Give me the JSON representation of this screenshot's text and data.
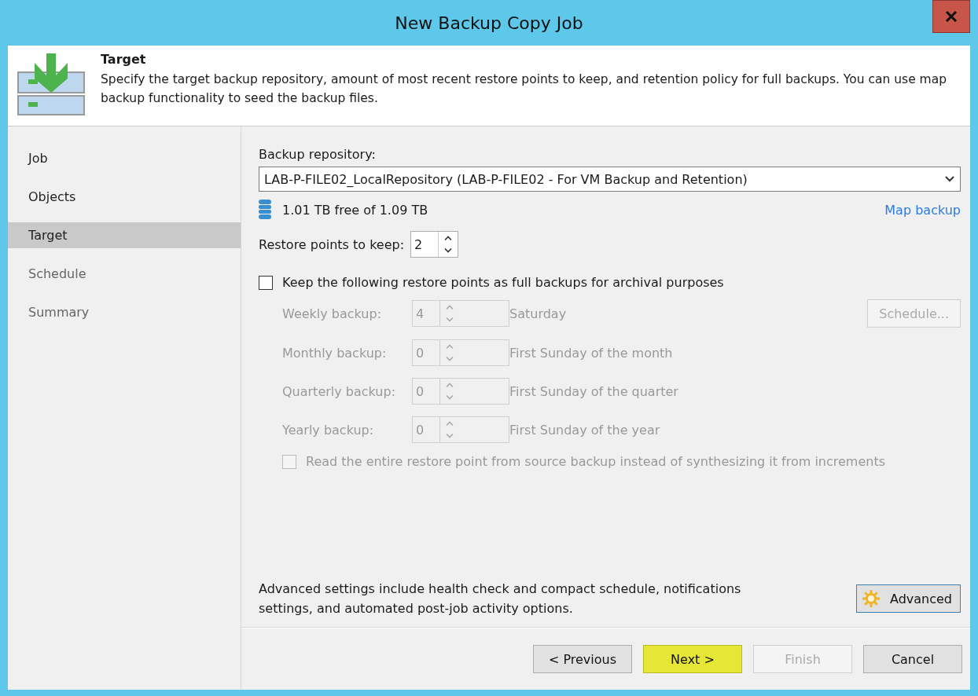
{
  "window": {
    "title": "New Backup Copy Job"
  },
  "header": {
    "title": "Target",
    "description": "Specify the target backup repository, amount of most recent restore points to keep, and retention policy for full backups. You can use map backup functionality to seed the backup files."
  },
  "steps": [
    {
      "label": "Job",
      "selected": false
    },
    {
      "label": "Objects",
      "selected": false
    },
    {
      "label": "Target",
      "selected": true
    },
    {
      "label": "Schedule",
      "selected": false
    },
    {
      "label": "Summary",
      "selected": false
    }
  ],
  "repository": {
    "label": "Backup repository:",
    "value": "LAB-P-FILE02_LocalRepository (LAB-P-FILE02 - For VM Backup and Retention)",
    "free": "1.01 TB free of 1.09 TB",
    "map_link": "Map backup"
  },
  "restore_points": {
    "label": "Restore points to keep:",
    "value": "2"
  },
  "archival": {
    "label": "Keep the following restore points as full backups for archival purposes",
    "checked": false
  },
  "retention": [
    {
      "label": "Weekly backup:",
      "value": "4",
      "when": "Saturday",
      "disabled": true
    },
    {
      "label": "Monthly backup:",
      "value": "0",
      "when": "First Sunday of the month",
      "disabled": true
    },
    {
      "label": "Quarterly backup:",
      "value": "0",
      "when": "First Sunday of the quarter",
      "disabled": true
    },
    {
      "label": "Yearly backup:",
      "value": "0",
      "when": "First Sunday of the year",
      "disabled": true
    }
  ],
  "schedule_button": {
    "label": "Schedule...",
    "disabled": true
  },
  "read_entire": {
    "label": "Read the entire restore point from source backup instead of synthesizing it from increments",
    "checked": false,
    "disabled": true
  },
  "advanced": {
    "text": "Advanced settings include health check and compact schedule, notifications settings, and automated post-job activity options.",
    "button": "Advanced"
  },
  "buttons": [
    {
      "label": "< Previous",
      "kind": "normal"
    },
    {
      "label": "Next >",
      "kind": "highlighted"
    },
    {
      "label": "Finish",
      "kind": "disabled"
    },
    {
      "label": "Cancel",
      "kind": "normal"
    }
  ]
}
